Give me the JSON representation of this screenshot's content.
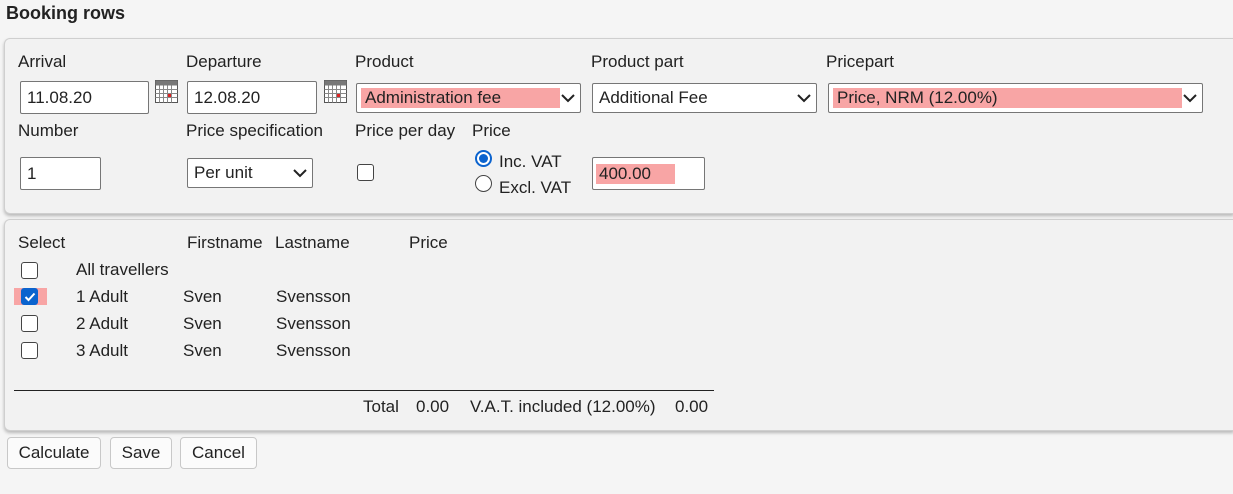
{
  "page_title": "Booking rows",
  "form": {
    "arrival": {
      "label": "Arrival",
      "value": "11.08.20"
    },
    "departure": {
      "label": "Departure",
      "value": "12.08.20"
    },
    "product": {
      "label": "Product",
      "value": "Administration fee"
    },
    "product_part": {
      "label": "Product part",
      "value": "Additional Fee"
    },
    "pricepart": {
      "label": "Pricepart",
      "value": "Price, NRM (12.00%)"
    },
    "number": {
      "label": "Number",
      "value": "1"
    },
    "price_specification": {
      "label": "Price specification",
      "value": "Per unit"
    },
    "price_per_day": {
      "label": "Price per day",
      "checked": false
    },
    "price": {
      "label": "Price",
      "inc_vat_label": "Inc. VAT",
      "excl_vat_label": "Excl. VAT",
      "selected": "Inc. VAT",
      "value": "400.00"
    }
  },
  "travellers": {
    "headers": {
      "select": "Select",
      "firstname": "Firstname",
      "lastname": "Lastname",
      "price": "Price"
    },
    "all_label": "All travellers",
    "rows": [
      {
        "label": "1 Adult",
        "firstname": "Sven",
        "lastname": "Svensson",
        "checked": true
      },
      {
        "label": "2 Adult",
        "firstname": "Sven",
        "lastname": "Svensson",
        "checked": false
      },
      {
        "label": "3 Adult",
        "firstname": "Sven",
        "lastname": "Svensson",
        "checked": false
      }
    ]
  },
  "totals": {
    "total_label": "Total",
    "total_value": "0.00",
    "vat_label": "V.A.T. included (12.00%)",
    "vat_value": "0.00"
  },
  "buttons": {
    "calculate": "Calculate",
    "save": "Save",
    "cancel": "Cancel"
  },
  "colors": {
    "highlight": "#f8a5a5",
    "checkbox_accent": "#0b63ce"
  },
  "icons": {
    "calendar": "calendar-icon",
    "dropdown": "chevron-down-icon"
  }
}
